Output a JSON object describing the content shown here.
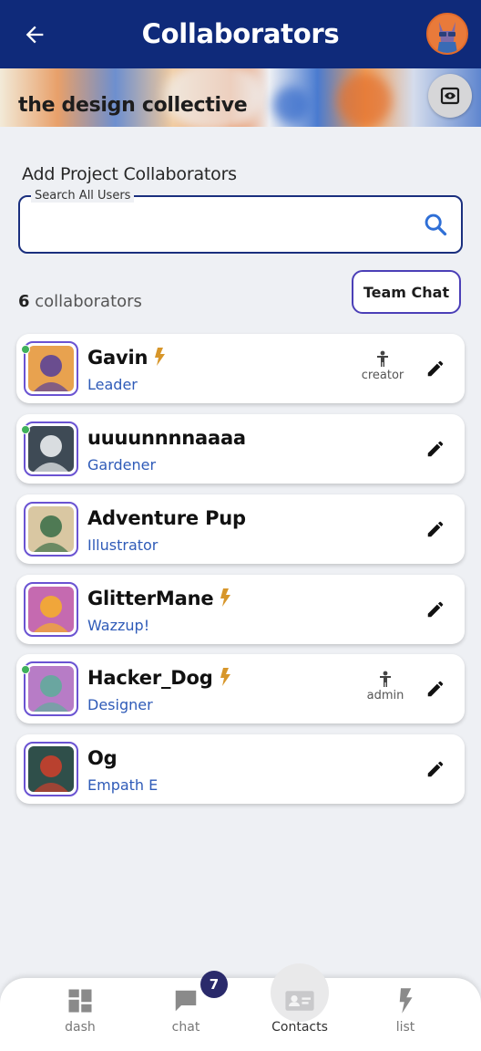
{
  "header": {
    "title": "Collaborators",
    "back_icon": "arrow-left-icon",
    "avatar_icon": "user-avatar"
  },
  "banner": {
    "project_name": "the design collective",
    "view_icon": "eye-box-icon"
  },
  "add_section": {
    "title": "Add Project Collaborators",
    "search_label": "Search All Users",
    "search_value": "",
    "search_icon": "search-icon"
  },
  "collaborators_bar": {
    "count": "6",
    "count_suffix": " collaborators",
    "team_chat_label": "Team Chat"
  },
  "collaborators": [
    {
      "name": "Gavin",
      "role": "Leader",
      "online": true,
      "bolt": true,
      "permission": "creator",
      "avatar_colors": [
        "#e8a24f",
        "#6a4d8f"
      ]
    },
    {
      "name": "uuuunnnnaaaa",
      "role": "Gardener",
      "online": true,
      "bolt": false,
      "permission": "",
      "avatar_colors": [
        "#3e4a55",
        "#d9dde0"
      ]
    },
    {
      "name": "Adventure Pup",
      "role": "Illustrator",
      "online": false,
      "bolt": false,
      "permission": "",
      "avatar_colors": [
        "#d9c7a2",
        "#4f7a54"
      ]
    },
    {
      "name": "GlitterMane",
      "role": "Wazzup!",
      "online": false,
      "bolt": true,
      "permission": "",
      "avatar_colors": [
        "#c56ab0",
        "#f0a63a"
      ]
    },
    {
      "name": "Hacker_Dog",
      "role": "Designer",
      "online": true,
      "bolt": true,
      "permission": "admin",
      "avatar_colors": [
        "#b77cc6",
        "#6aa6a0"
      ]
    },
    {
      "name": "Og",
      "role": "Empath E",
      "online": false,
      "bolt": false,
      "permission": "",
      "avatar_colors": [
        "#2f4f4a",
        "#b9412f"
      ]
    }
  ],
  "bottom_nav": {
    "items": [
      {
        "label": "dash",
        "icon": "dashboard-grid-icon"
      },
      {
        "label": "chat",
        "icon": "chat-bubble-icon",
        "badge": "7"
      },
      {
        "label": "Contacts",
        "icon": "contact-card-icon",
        "active": true
      },
      {
        "label": "list",
        "icon": "lightning-icon"
      }
    ]
  },
  "colors": {
    "header_bg": "#0f2a7a",
    "accent_purple": "#4b3fb7",
    "role_blue": "#2f5bb8",
    "bolt_gold": "#d7962a",
    "online_green": "#3fb05b"
  }
}
